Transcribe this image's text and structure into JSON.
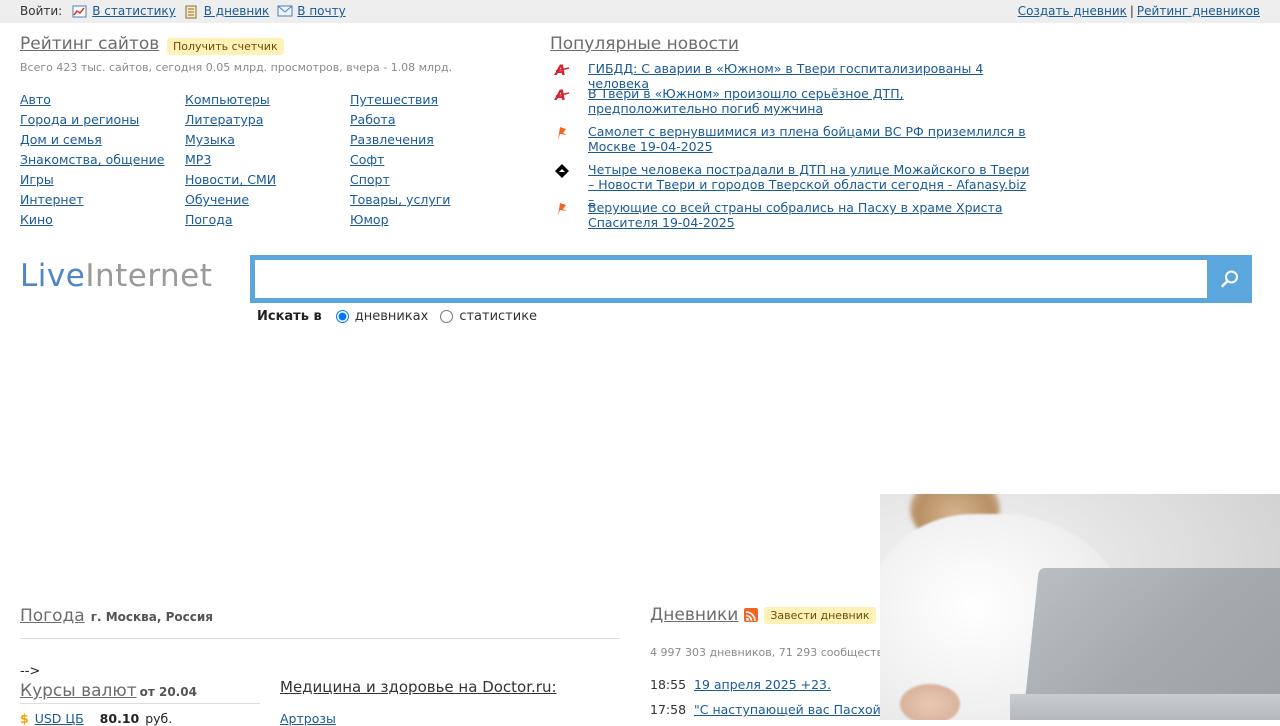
{
  "topbar": {
    "login_label": "Войти:",
    "links": [
      {
        "label": "В статистику",
        "icon": "chart-icon"
      },
      {
        "label": "В дневник",
        "icon": "notebook-icon"
      },
      {
        "label": "В почту",
        "icon": "mail-icon"
      }
    ],
    "right_links": [
      {
        "label": "Создать дневник"
      },
      {
        "label": "Рейтинг дневников"
      }
    ],
    "separator": "|"
  },
  "rating": {
    "title": "Рейтинг сайтов",
    "counter_badge": "Получить счетчик",
    "stats": "Всего 423 тыс. сайтов, сегодня 0.05 млрд. просмотров, вчера - 1.08 млрд.",
    "categories": [
      [
        "Авто",
        "Города и регионы",
        "Дом и семья",
        "Знакомства, общение",
        "Игры",
        "Интернет",
        "Кино"
      ],
      [
        "Компьютеры",
        "Литература",
        "Музыка",
        "MP3",
        "Новости, СМИ",
        "Обучение",
        "Погода"
      ],
      [
        "Путешествия",
        "Работа",
        "Развлечения",
        "Софт",
        "Спорт",
        "Товары, услуги",
        "Юмор"
      ]
    ]
  },
  "news": {
    "title": "Популярные новости",
    "items": [
      {
        "text": "ГИБДД: С аварии в «Южном» в Твери госпитализированы 4 человека",
        "icon": "source-a-icon",
        "color": "#d9232e"
      },
      {
        "text": "В Твери в «Южном» произошло серьёзное ДТП, предположительно погиб мужчина",
        "icon": "source-a-icon",
        "color": "#d9232e"
      },
      {
        "text": "Самолет с вернувшимися из плена бойцами ВС РФ приземлился в Москве 19-04-2025",
        "icon": "source-r-icon",
        "color": "#f26522"
      },
      {
        "text": "Четыре человека пострадали в ДТП на улице Можайского в Твери – Новости Твери и городов Тверской области сегодня - Afanasy.biz –",
        "icon": "source-diamond-icon",
        "color": "#000000"
      },
      {
        "text": "Верующие со всей страны собрались на Пасху в храме Христа Спасителя 19-04-2025",
        "icon": "source-r-icon",
        "color": "#f26522"
      }
    ]
  },
  "logo": {
    "part1": "Live",
    "part2": "Internet"
  },
  "search": {
    "value": "",
    "placeholder": "",
    "search_in_label": "Искать в",
    "options": [
      {
        "label": "дневниках",
        "checked": true
      },
      {
        "label": "статистике",
        "checked": false
      }
    ],
    "accent_color": "#5aa6dd"
  },
  "weather": {
    "title": "Погода",
    "city": "г. Москва, Россия"
  },
  "stray_text": "-->",
  "rates": {
    "title": "Курсы валют",
    "date": "от 20.04",
    "rows": [
      {
        "currency": "USD ЦБ",
        "value": "80.10",
        "unit": "руб."
      }
    ]
  },
  "medicine": {
    "title": "Медицина и здоровье на Doctor.ru:",
    "first_item": "Артрозы"
  },
  "diaries": {
    "title": "Дневники",
    "create_badge": "Завести дневник",
    "stats": "4 997 303 дневников, 71 293 сообществ,",
    "rows": [
      {
        "time": "18:55",
        "text": "19 апреля 2025 +23."
      },
      {
        "time": "17:58",
        "text": "\"С наступающей вас Пасхой я"
      }
    ]
  }
}
